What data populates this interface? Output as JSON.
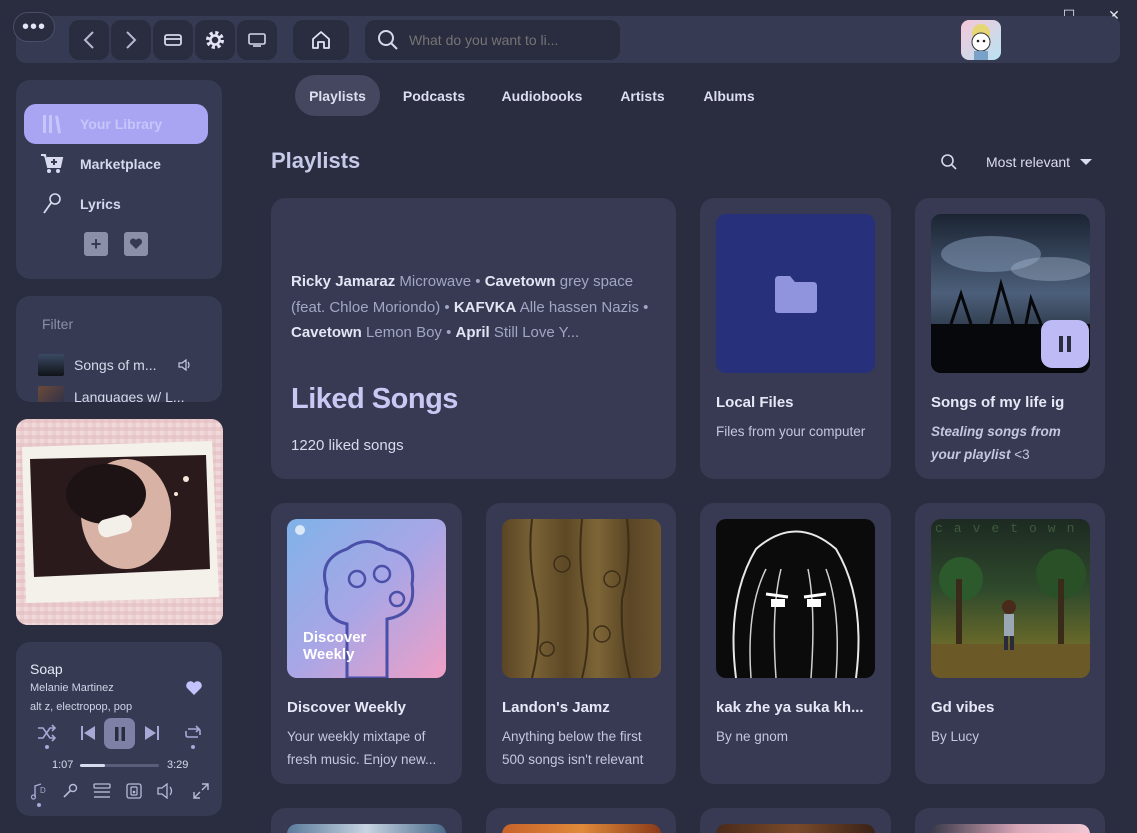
{
  "window": {
    "minimize": "—",
    "maximize": "☐",
    "close": "✕"
  },
  "topbar": {
    "search_placeholder": "What do you want to li..."
  },
  "sidebar": {
    "nav": [
      {
        "label": "Your Library"
      },
      {
        "label": "Marketplace"
      },
      {
        "label": "Lyrics"
      }
    ],
    "filter_placeholder": "Filter",
    "library_items": [
      {
        "label": "Songs of m..."
      },
      {
        "label": "Languages w/ L..."
      }
    ]
  },
  "now_playing": {
    "title": "Soap",
    "artist": "Melanie Martinez",
    "genres": "alt z,  electropop,  pop",
    "elapsed": "1:07",
    "duration": "3:29",
    "progress": 0.32
  },
  "tabs": [
    {
      "label": "Playlists",
      "active": true
    },
    {
      "label": "Podcasts"
    },
    {
      "label": "Audiobooks"
    },
    {
      "label": "Artists"
    },
    {
      "label": "Albums"
    }
  ],
  "section": {
    "title": "Playlists",
    "sort_label": "Most relevant"
  },
  "liked": {
    "preview": [
      {
        "artist": "Ricky Jamaraz",
        "song": "Microwave"
      },
      {
        "artist": "Cavetown",
        "song": "grey space (feat. Chloe Moriondo)"
      },
      {
        "artist": "KAFVKA",
        "song": "Alle hassen Nazis"
      },
      {
        "artist": "Cavetown",
        "song": "Lemon Boy"
      },
      {
        "artist": "April",
        "song": "Still Love Y..."
      }
    ],
    "title": "Liked Songs",
    "count": "1220 liked songs"
  },
  "cards": [
    {
      "title": "Local Files",
      "desc": "Files from your computer"
    },
    {
      "title": "Songs of my life ig",
      "desc_italic": "Stealing songs from your playlist",
      "desc_suffix": " <3"
    },
    {
      "title": "Discover Weekly",
      "desc": "Your weekly mixtape of fresh music. Enjoy new...",
      "art_text": "Discover Weekly"
    },
    {
      "title": "Landon's Jamz",
      "desc": "Anything below the first 500 songs isn't relevant"
    },
    {
      "title": "kak zhe ya suka kh...",
      "desc": "By ne gnom"
    },
    {
      "title": "Gd vibes",
      "desc": "By Lucy",
      "art_text": "cavetown"
    }
  ],
  "colors": {
    "background": "#2a2c3f",
    "panel": "#363a52",
    "accent": "#a9a5f3",
    "local_files_art": "#27307a"
  }
}
